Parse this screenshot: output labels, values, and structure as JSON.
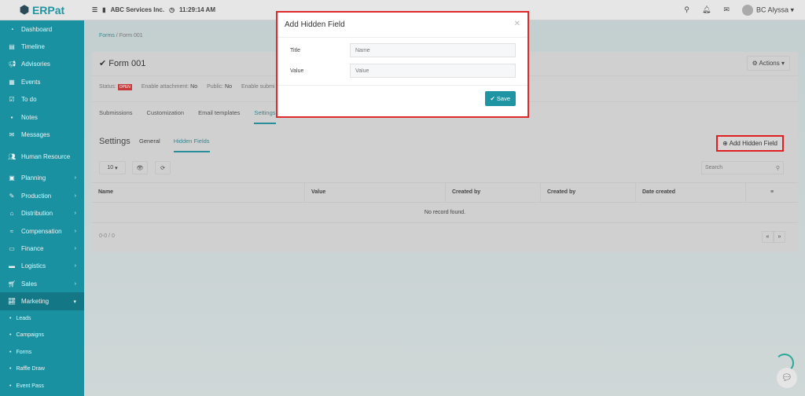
{
  "topbar": {
    "logo": "ERPat",
    "company": "ABC Services Inc.",
    "time": "11:29:14 AM",
    "user": "BC Alyssa"
  },
  "sidebar": {
    "items": [
      {
        "icon": "dashboard",
        "label": "Dashboard"
      },
      {
        "icon": "timeline",
        "label": "Timeline"
      },
      {
        "icon": "megaphone",
        "label": "Advisories"
      },
      {
        "icon": "calendar",
        "label": "Events"
      },
      {
        "icon": "checkbox",
        "label": "To do"
      },
      {
        "icon": "note",
        "label": "Notes"
      },
      {
        "icon": "envelope",
        "label": "Messages"
      },
      {
        "icon": "users",
        "label": "Human Resource"
      },
      {
        "icon": "planning",
        "label": "Planning"
      },
      {
        "icon": "production",
        "label": "Production"
      },
      {
        "icon": "bank",
        "label": "Distribution"
      },
      {
        "icon": "money",
        "label": "Compensation"
      },
      {
        "icon": "finance",
        "label": "Finance"
      },
      {
        "icon": "truck",
        "label": "Logistics"
      },
      {
        "icon": "cart",
        "label": "Sales"
      },
      {
        "icon": "chart",
        "label": "Marketing"
      }
    ],
    "subitems": [
      "Leads",
      "Campaigns",
      "Forms",
      "Raffle Draw",
      "Event Pass"
    ]
  },
  "breadcrumb": {
    "parent": "Forms",
    "current": "Form 001"
  },
  "form": {
    "title": "Form 001",
    "actions": "Actions",
    "status_label": "Status:",
    "status": "OPEN",
    "attachment_label": "Enable attachment:",
    "attachment": "No",
    "public_label": "Public:",
    "public": "No",
    "submit_label": "Enable submi"
  },
  "tabs": [
    "Submissions",
    "Customization",
    "Email templates",
    "Settings"
  ],
  "settings": {
    "title": "Settings",
    "subtabs": [
      "General",
      "Hidden Fields"
    ],
    "add_button": "Add Hidden Field",
    "page_size": "10",
    "search_placeholder": "Search",
    "columns": [
      "Name",
      "Value",
      "Created by",
      "Created by",
      "Date created"
    ],
    "empty": "No record found.",
    "footer": "0-0 / 0"
  },
  "modal": {
    "title": "Add Hidden Field",
    "title_label": "Title",
    "title_placeholder": "Name",
    "value_label": "Value",
    "value_placeholder": "Value",
    "save": "Save"
  }
}
